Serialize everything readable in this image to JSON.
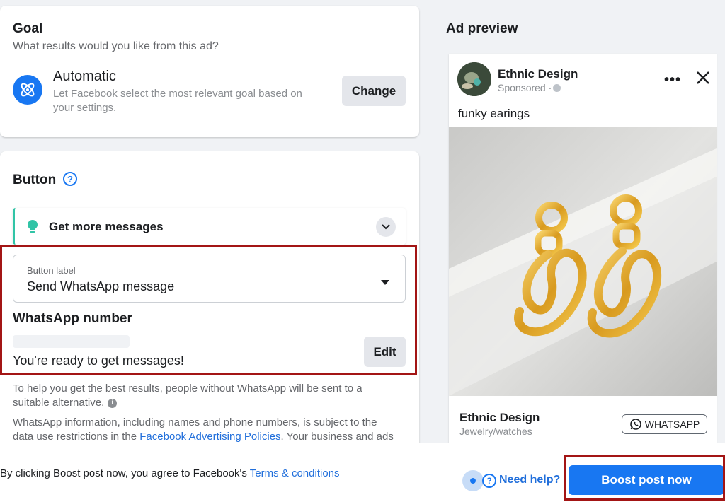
{
  "goal": {
    "title": "Goal",
    "subtitle": "What results would you like from this ad?",
    "option_title": "Automatic",
    "option_desc_line1": "Let Facebook select the most relevant goal based on",
    "option_desc_line2": "your settings.",
    "change_label": "Change"
  },
  "button_section": {
    "title": "Button",
    "help_glyph": "?",
    "objective_label": "Get more messages",
    "button_label_caption": "Button label",
    "button_label_value": "Send WhatsApp message",
    "whatsapp_number_title": "WhatsApp number",
    "ready_text": "You're ready to get messages!",
    "edit_label": "Edit",
    "help_text_line1": "To help you get the best results, people without WhatsApp will be sent to a",
    "help_text_line2": "suitable alternative.",
    "info_text_line1": "WhatsApp information, including names and phone numbers, is subject to the",
    "info_text_line2_prefix": "data use restrictions in the ",
    "info_text_link": "Facebook Advertising Policies",
    "info_text_line2_suffix": ". Your business and ads"
  },
  "ad_preview": {
    "title": "Ad preview",
    "page_name": "Ethnic Design",
    "sponsored": "Sponsored · ",
    "caption": "funky earings",
    "footer_name": "Ethnic Design",
    "footer_category": "Jewelry/watches",
    "cta_label": "WHATSAPP"
  },
  "footer": {
    "consent_prefix": "By clicking Boost post now, you agree to Facebook's ",
    "terms_link": "Terms & conditions",
    "need_help": "Need help?",
    "boost_label": "Boost post now"
  },
  "colors": {
    "brand_blue": "#1877f2",
    "highlight_red": "#a31515",
    "accent_teal": "#31c4a6"
  }
}
